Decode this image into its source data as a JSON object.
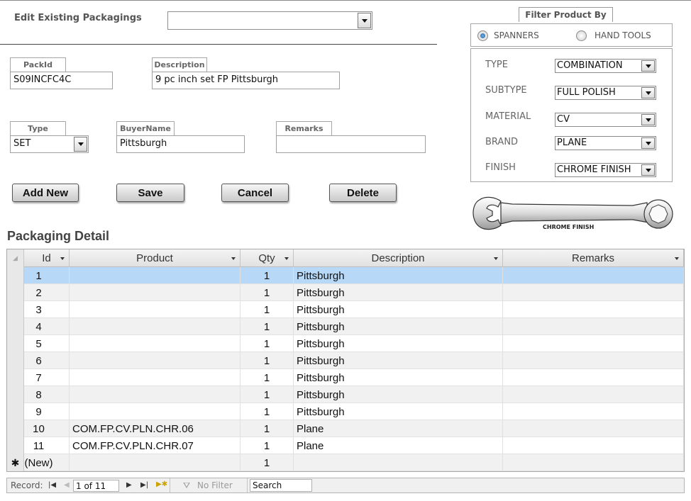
{
  "header": {
    "edit_label": "Edit Existing Packagings",
    "edit_value": ""
  },
  "fields": {
    "packid_label": "PackId",
    "packid_value": "S09INCFC4C",
    "description_label": "Description",
    "description_value": "9 pc inch set FP Pittsburgh",
    "type_label": "Type",
    "type_value": "SET",
    "buyer_label": "BuyerName",
    "buyer_value": "Pittsburgh",
    "remarks_label": "Remarks",
    "remarks_value": ""
  },
  "buttons": {
    "add_new": "Add New",
    "save": "Save",
    "cancel": "Cancel",
    "delete": "Delete"
  },
  "filter": {
    "title": "Filter Product By",
    "radio_spanners": "SPANNERS",
    "radio_handtools": "HAND TOOLS",
    "selected": "SPANNERS",
    "type_label": "TYPE",
    "type_value": "COMBINATION",
    "subtype_label": "SUBTYPE",
    "subtype_value": "FULL POLISH",
    "material_label": "MATERIAL",
    "material_value": "CV",
    "brand_label": "BRAND",
    "brand_value": "PLANE",
    "finish_label": "FINISH",
    "finish_value": "CHROME FINISH",
    "image_caption": "CHROME FINISH"
  },
  "detail": {
    "title": "Packaging Detail",
    "columns": [
      "Id",
      "Product",
      "Qty",
      "Description",
      "Remarks"
    ],
    "rows": [
      {
        "id": "1",
        "product": "",
        "qty": "1",
        "description": "Pittsburgh",
        "remarks": ""
      },
      {
        "id": "2",
        "product": "",
        "qty": "1",
        "description": "Pittsburgh",
        "remarks": ""
      },
      {
        "id": "3",
        "product": "",
        "qty": "1",
        "description": "Pittsburgh",
        "remarks": ""
      },
      {
        "id": "4",
        "product": "",
        "qty": "1",
        "description": "Pittsburgh",
        "remarks": ""
      },
      {
        "id": "5",
        "product": "",
        "qty": "1",
        "description": "Pittsburgh",
        "remarks": ""
      },
      {
        "id": "6",
        "product": "",
        "qty": "1",
        "description": "Pittsburgh",
        "remarks": ""
      },
      {
        "id": "7",
        "product": "",
        "qty": "1",
        "description": "Pittsburgh",
        "remarks": ""
      },
      {
        "id": "8",
        "product": "",
        "qty": "1",
        "description": "Pittsburgh",
        "remarks": ""
      },
      {
        "id": "9",
        "product": "",
        "qty": "1",
        "description": "Pittsburgh",
        "remarks": ""
      },
      {
        "id": "10",
        "product": "COM.FP.CV.PLN.CHR.06",
        "qty": "1",
        "description": "Plane",
        "remarks": ""
      },
      {
        "id": "11",
        "product": "COM.FP.CV.PLN.CHR.07",
        "qty": "1",
        "description": "Plane",
        "remarks": ""
      },
      {
        "id": "(New)",
        "product": "",
        "qty": "1",
        "description": "",
        "remarks": ""
      }
    ]
  },
  "navigator": {
    "record_label": "Record:",
    "position": "1 of 11",
    "filter_label": "No Filter",
    "search_label": "Search"
  },
  "colors": {
    "selected_row": "#b7d9f7",
    "alt_row": "#f1f1f1",
    "radio_on": "#1f5f9e"
  }
}
